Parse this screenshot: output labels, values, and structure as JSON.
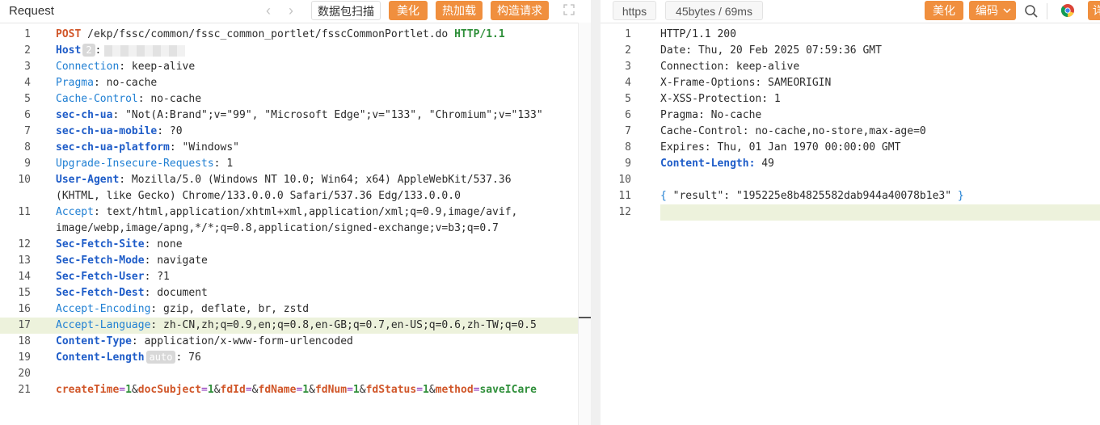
{
  "left": {
    "title": "Request",
    "buttons": {
      "scan": "数据包扫描",
      "beautify": "美化",
      "hot_load": "热加载",
      "construct": "构造请求"
    },
    "lines": [
      {
        "n": "1",
        "method": "POST",
        "path": " /ekp/fssc/common/fssc_common_portlet/fsscCommonPortlet.do ",
        "proto": "HTTP/1.1"
      },
      {
        "n": "2",
        "key": "Host",
        "badge": "2",
        "sep": ":"
      },
      {
        "n": "3",
        "key": "Connection",
        "val": ": keep-alive"
      },
      {
        "n": "4",
        "key": "Pragma",
        "val": ": no-cache"
      },
      {
        "n": "5",
        "key": "Cache-Control",
        "val": ": no-cache"
      },
      {
        "n": "6",
        "key": "sec-ch-ua",
        "val": ": \"Not(A:Brand\";v=\"99\", \"Microsoft Edge\";v=\"133\", \"Chromium\";v=\"133\""
      },
      {
        "n": "7",
        "key": "sec-ch-ua-mobile",
        "val": ": ?0"
      },
      {
        "n": "8",
        "key": "sec-ch-ua-platform",
        "val": ": \"Windows\""
      },
      {
        "n": "9",
        "key": "Upgrade-Insecure-Requests",
        "val": ": 1"
      },
      {
        "n": "10",
        "key": "User-Agent",
        "val": ": Mozilla/5.0 (Windows NT 10.0; Win64; x64) AppleWebKit/537.36 "
      },
      {
        "n": "",
        "val": "(KHTML, like Gecko) Chrome/133.0.0.0 Safari/537.36 Edg/133.0.0.0"
      },
      {
        "n": "11",
        "key": "Accept",
        "val": ": text/html,application/xhtml+xml,application/xml;q=0.9,image/avif,"
      },
      {
        "n": "",
        "val": "image/webp,image/apng,*/*;q=0.8,application/signed-exchange;v=b3;q=0.7"
      },
      {
        "n": "12",
        "key": "Sec-Fetch-Site",
        "val": ": none"
      },
      {
        "n": "13",
        "key": "Sec-Fetch-Mode",
        "val": ": navigate"
      },
      {
        "n": "14",
        "key": "Sec-Fetch-User",
        "val": ": ?1"
      },
      {
        "n": "15",
        "key": "Sec-Fetch-Dest",
        "val": ": document"
      },
      {
        "n": "16",
        "key": "Accept-Encoding",
        "val": ": gzip, deflate, br, zstd"
      },
      {
        "n": "17",
        "key": "Accept-Language",
        "val": ": zh-CN,zh;q=0.9,en;q=0.8,en-GB;q=0.7,en-US;q=0.6,zh-TW;q=0.5"
      },
      {
        "n": "18",
        "key": "Content-Type",
        "val": ": application/x-www-form-urlencoded"
      },
      {
        "n": "19",
        "key": "Content-Length",
        "badge": "auto",
        "val": ": 76"
      },
      {
        "n": "20"
      },
      {
        "n": "21",
        "params": [
          {
            "k": "createTime",
            "v": "1"
          },
          {
            "k": "docSubject",
            "v": "1"
          },
          {
            "k": "fdId",
            "v": ""
          },
          {
            "k": "fdName",
            "v": "1"
          },
          {
            "k": "fdNum",
            "v": "1"
          },
          {
            "k": "fdStatus",
            "v": "1"
          },
          {
            "k": "method",
            "v": "saveICare"
          }
        ]
      }
    ]
  },
  "right": {
    "tags": {
      "protocol": "https",
      "size": "45bytes / 69ms"
    },
    "buttons": {
      "beautify": "美化",
      "encoding": "编码",
      "last": "详"
    },
    "lines": [
      {
        "n": "1",
        "val": "HTTP/1.1 200"
      },
      {
        "n": "2",
        "val": "Date: Thu, 20 Feb 2025 07:59:36 GMT"
      },
      {
        "n": "3",
        "val": "Connection: keep-alive"
      },
      {
        "n": "4",
        "val": "X-Frame-Options: SAMEORIGIN"
      },
      {
        "n": "5",
        "val": "X-XSS-Protection: 1"
      },
      {
        "n": "6",
        "val": "Pragma: No-cache"
      },
      {
        "n": "7",
        "val": "Cache-Control: no-cache,no-store,max-age=0"
      },
      {
        "n": "8",
        "val": "Expires: Thu, 01 Jan 1970 00:00:00 GMT"
      },
      {
        "n": "9",
        "key": "Content-Length:",
        "val": " 49"
      },
      {
        "n": "10"
      },
      {
        "n": "11",
        "json": true,
        "jkey": "\"result\"",
        "jval": "\"195225e8b4825582dab944a40078b1e3\""
      },
      {
        "n": "12"
      }
    ]
  },
  "colors": {
    "accent": "#f08f3e",
    "highlight": "#edf2dc"
  },
  "icons": [
    "chevron-left-icon",
    "chevron-right-icon",
    "expand-icon",
    "search-icon",
    "chrome-icon",
    "chevron-down-icon"
  ]
}
